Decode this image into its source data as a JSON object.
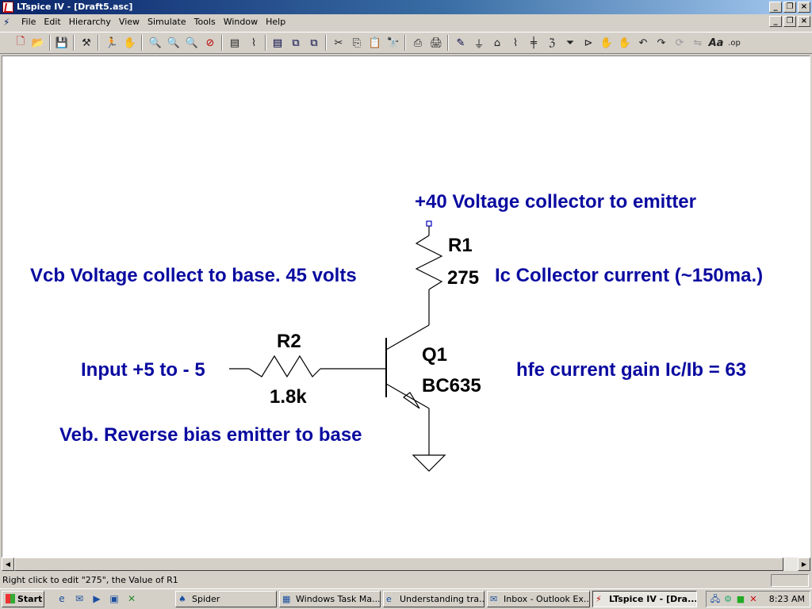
{
  "window": {
    "title": "LTspice IV - [Draft5.asc]"
  },
  "menu": [
    "File",
    "Edit",
    "Hierarchy",
    "View",
    "Simulate",
    "Tools",
    "Window",
    "Help"
  ],
  "toolbar_icons": [
    "new-schematic-icon",
    "open-icon",
    "save-icon",
    "control-panel-icon",
    "run-icon",
    "halt-icon",
    "zoom-in-icon",
    "zoom-area-icon",
    "zoom-out-icon",
    "zoom-cancel-icon",
    "autorange-icon",
    "waveform-icon",
    "tile-vertical-icon",
    "cascade-icon",
    "tile-horizontal-icon",
    "cut-icon",
    "copy-icon",
    "paste-icon",
    "find-icon",
    "print-setup-icon",
    "print-icon",
    "draw-wire-icon",
    "ground-icon",
    "label-net-icon",
    "resistor-icon",
    "capacitor-icon",
    "inductor-icon",
    "diode-icon",
    "component-icon",
    "move-icon",
    "drag-icon",
    "undo-icon",
    "redo-icon",
    "rotate-icon",
    "mirror-icon",
    "text-icon",
    "spice-directive-icon"
  ],
  "schematic": {
    "annotation_top": "+40 Voltage collector to emitter",
    "r1_name": "R1",
    "r1_value": "275",
    "vcb_note": "Vcb Voltage collect to base. 45 volts",
    "ic_note": "Ic Collector current (~150ma.)",
    "r2_name": "R2",
    "r2_value": "1.8k",
    "input_note": "Input +5 to - 5",
    "q1_name": "Q1",
    "q1_model": "BC635",
    "hfe_note": "hfe current gain Ic/Ib = 63",
    "veb_note": "Veb. Reverse bias emitter to base",
    "label_color": "#0a0aa0"
  },
  "status": {
    "text": "Right click to edit \"275\", the Value of R1"
  },
  "taskbar": {
    "start": "Start",
    "tasks": [
      "Spider",
      "Windows Task Ma...",
      "Understanding tra...",
      "Inbox - Outlook Ex...",
      "LTspice IV - [Dra..."
    ],
    "clock": "8:23 AM"
  }
}
